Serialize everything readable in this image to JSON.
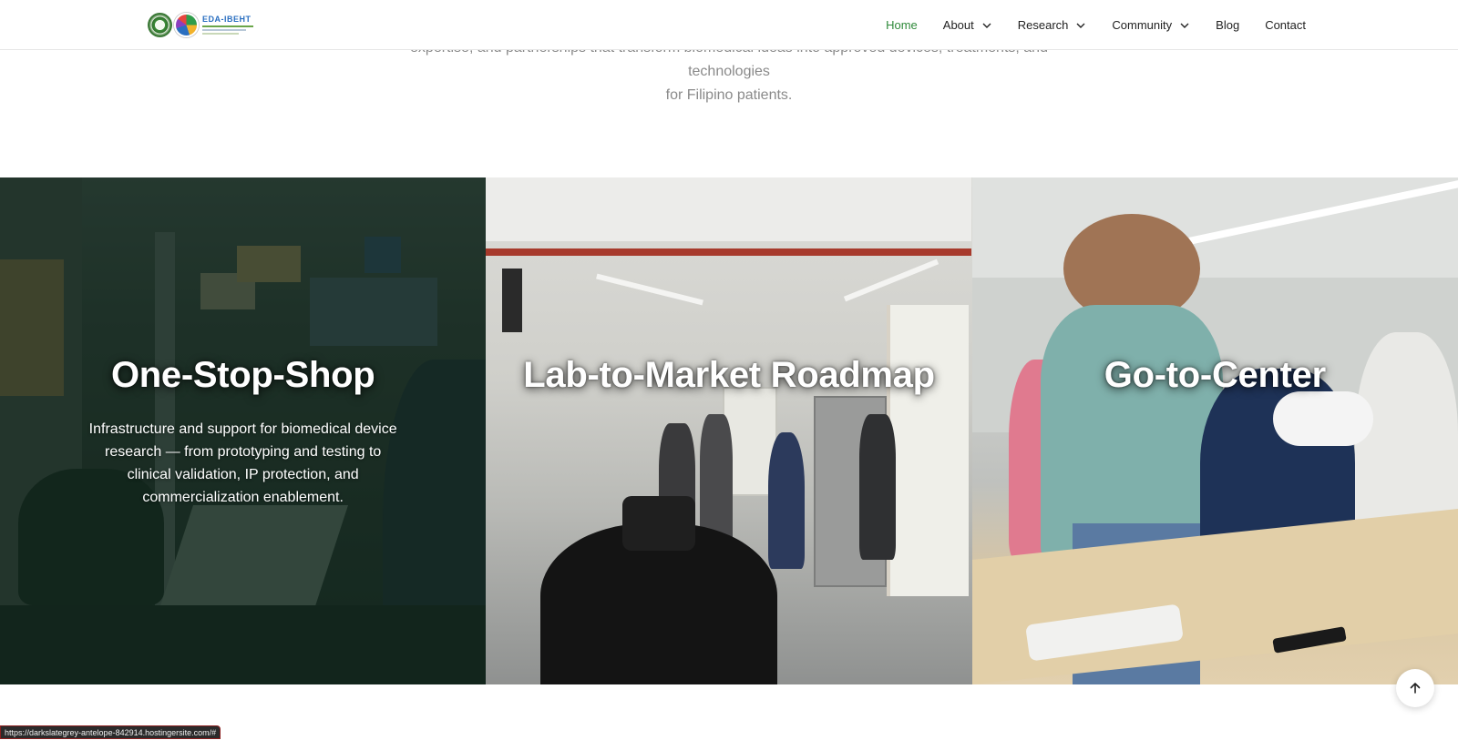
{
  "intro": {
    "line1": "expertise, and partnerships that transform biomedical ideas into approved devices, treatments, and technologies",
    "line2": "for Filipino patients."
  },
  "header": {
    "logo": {
      "wordmark": "EDA-IBEHT",
      "seal_icon": "university-seal-icon",
      "orb_icon": "ibeht-emblem-icon"
    },
    "nav": [
      {
        "label": "Home",
        "active": true,
        "has_dropdown": false
      },
      {
        "label": "About",
        "active": false,
        "has_dropdown": true
      },
      {
        "label": "Research",
        "active": false,
        "has_dropdown": true
      },
      {
        "label": "Community",
        "active": false,
        "has_dropdown": true
      },
      {
        "label": "Blog",
        "active": false,
        "has_dropdown": false
      },
      {
        "label": "Contact",
        "active": false,
        "has_dropdown": false
      }
    ]
  },
  "panels": [
    {
      "title": "One-Stop-Shop",
      "description": "Infrastructure and support for biomedical device research — from prototyping and testing to clinical validation, IP protection, and commercialization enablement."
    },
    {
      "title": "Lab-to-Market Roadmap",
      "description": ""
    },
    {
      "title": "Go-to-Center",
      "description": ""
    }
  ],
  "status_bar": {
    "url": "https://darkslategrey-antelope-842914.hostingersite.com/#"
  },
  "back_to_top": {
    "icon": "arrow-up-icon"
  },
  "colors": {
    "accent": "#2f8a3a",
    "text": "#222222",
    "muted": "#8a8a8a"
  }
}
